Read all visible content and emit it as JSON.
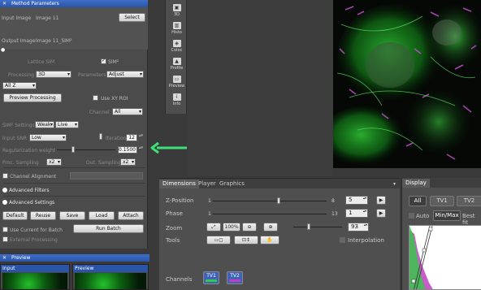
{
  "method_params": {
    "header": "Method Parameters",
    "input_label": "Input Image",
    "input_value": "Image 11",
    "select_button": "Select",
    "output_label": "Output Image",
    "output_value": "Image 11_SIM²",
    "lattice_sim_label": "Lattice SIM",
    "sim_checkbox_label": "SIM²",
    "processing_label": "Processing",
    "processing_value": "3D",
    "parameters_label": "Parameters",
    "parameters_value": "Adjust",
    "allz_value": "All Z",
    "preview_processing_button": "Preview Processing",
    "use_xy_roi_label": "Use XY ROI",
    "channel_label": "Channel",
    "channel_value": "All",
    "sim_settings_label": "SIM² Settings",
    "sim_settings_value": "Weak",
    "sim_live_value": "Live",
    "input_snr_label": "Input SNR",
    "input_snr_value": "Low",
    "iterations_label": "Iterations",
    "iterations_value": "12",
    "reg_weight_label": "Regularization weight",
    "reg_weight_value": "0.1500",
    "proc_sampling_label": "Proc. Sampling",
    "proc_sampling_value": "x2",
    "out_sampling_label": "Out. Sampling",
    "out_sampling_value": "x2",
    "channel_alignment_label": "Channel Alignment",
    "advanced_filters_label": "Advanced Filters",
    "advanced_settings_label": "Advanced Settings",
    "buttons": [
      "Default",
      "Reuse",
      "Save",
      "Load",
      "Attach"
    ],
    "use_current_for_batch_label": "Use Current for Batch",
    "run_batch_button": "Run Batch",
    "external_processing_label": "External Processing"
  },
  "preview": {
    "header": "Preview",
    "input_label": "Input",
    "preview_label": "Preview"
  },
  "tools": [
    {
      "label": "3D",
      "icon": "3d-icon"
    },
    {
      "label": "Histo",
      "icon": "histogram-icon"
    },
    {
      "label": "Coloc",
      "icon": "colocalization-icon"
    },
    {
      "label": "Profile",
      "icon": "profile-icon"
    },
    {
      "label": "Preview",
      "icon": "preview-icon"
    },
    {
      "label": "Info",
      "icon": "info-icon"
    }
  ],
  "dimensions": {
    "tabs": [
      "Dimensions",
      "Player",
      "Graphics"
    ],
    "z_position_label": "Z-Position",
    "z_min": "1",
    "z_max": "8",
    "z_value": "5",
    "phase_label": "Phase",
    "phase_min": "1",
    "phase_max": "13",
    "phase_value": "1",
    "zoom_label": "Zoom",
    "zoom_100_label": "100%",
    "zoom_value": "93",
    "tools_label": "Tools",
    "interpolation_label": "Interpolation",
    "channels_label": "Channels",
    "channels": [
      {
        "name": "TV1",
        "color": "#2ecc40"
      },
      {
        "name": "TV2",
        "color": "#c040c0"
      }
    ]
  },
  "display": {
    "tab": "Display",
    "buttons": [
      "All",
      "TV1",
      "TV2"
    ],
    "auto_label": "Auto",
    "minmax_label": "Min/Max",
    "bestfit_label": "Best fit"
  },
  "colors": {
    "header_blue": "#2a54a8",
    "arrow_green": "#3ee07a",
    "channel1": "#2ecc40",
    "channel2": "#c040c0"
  }
}
